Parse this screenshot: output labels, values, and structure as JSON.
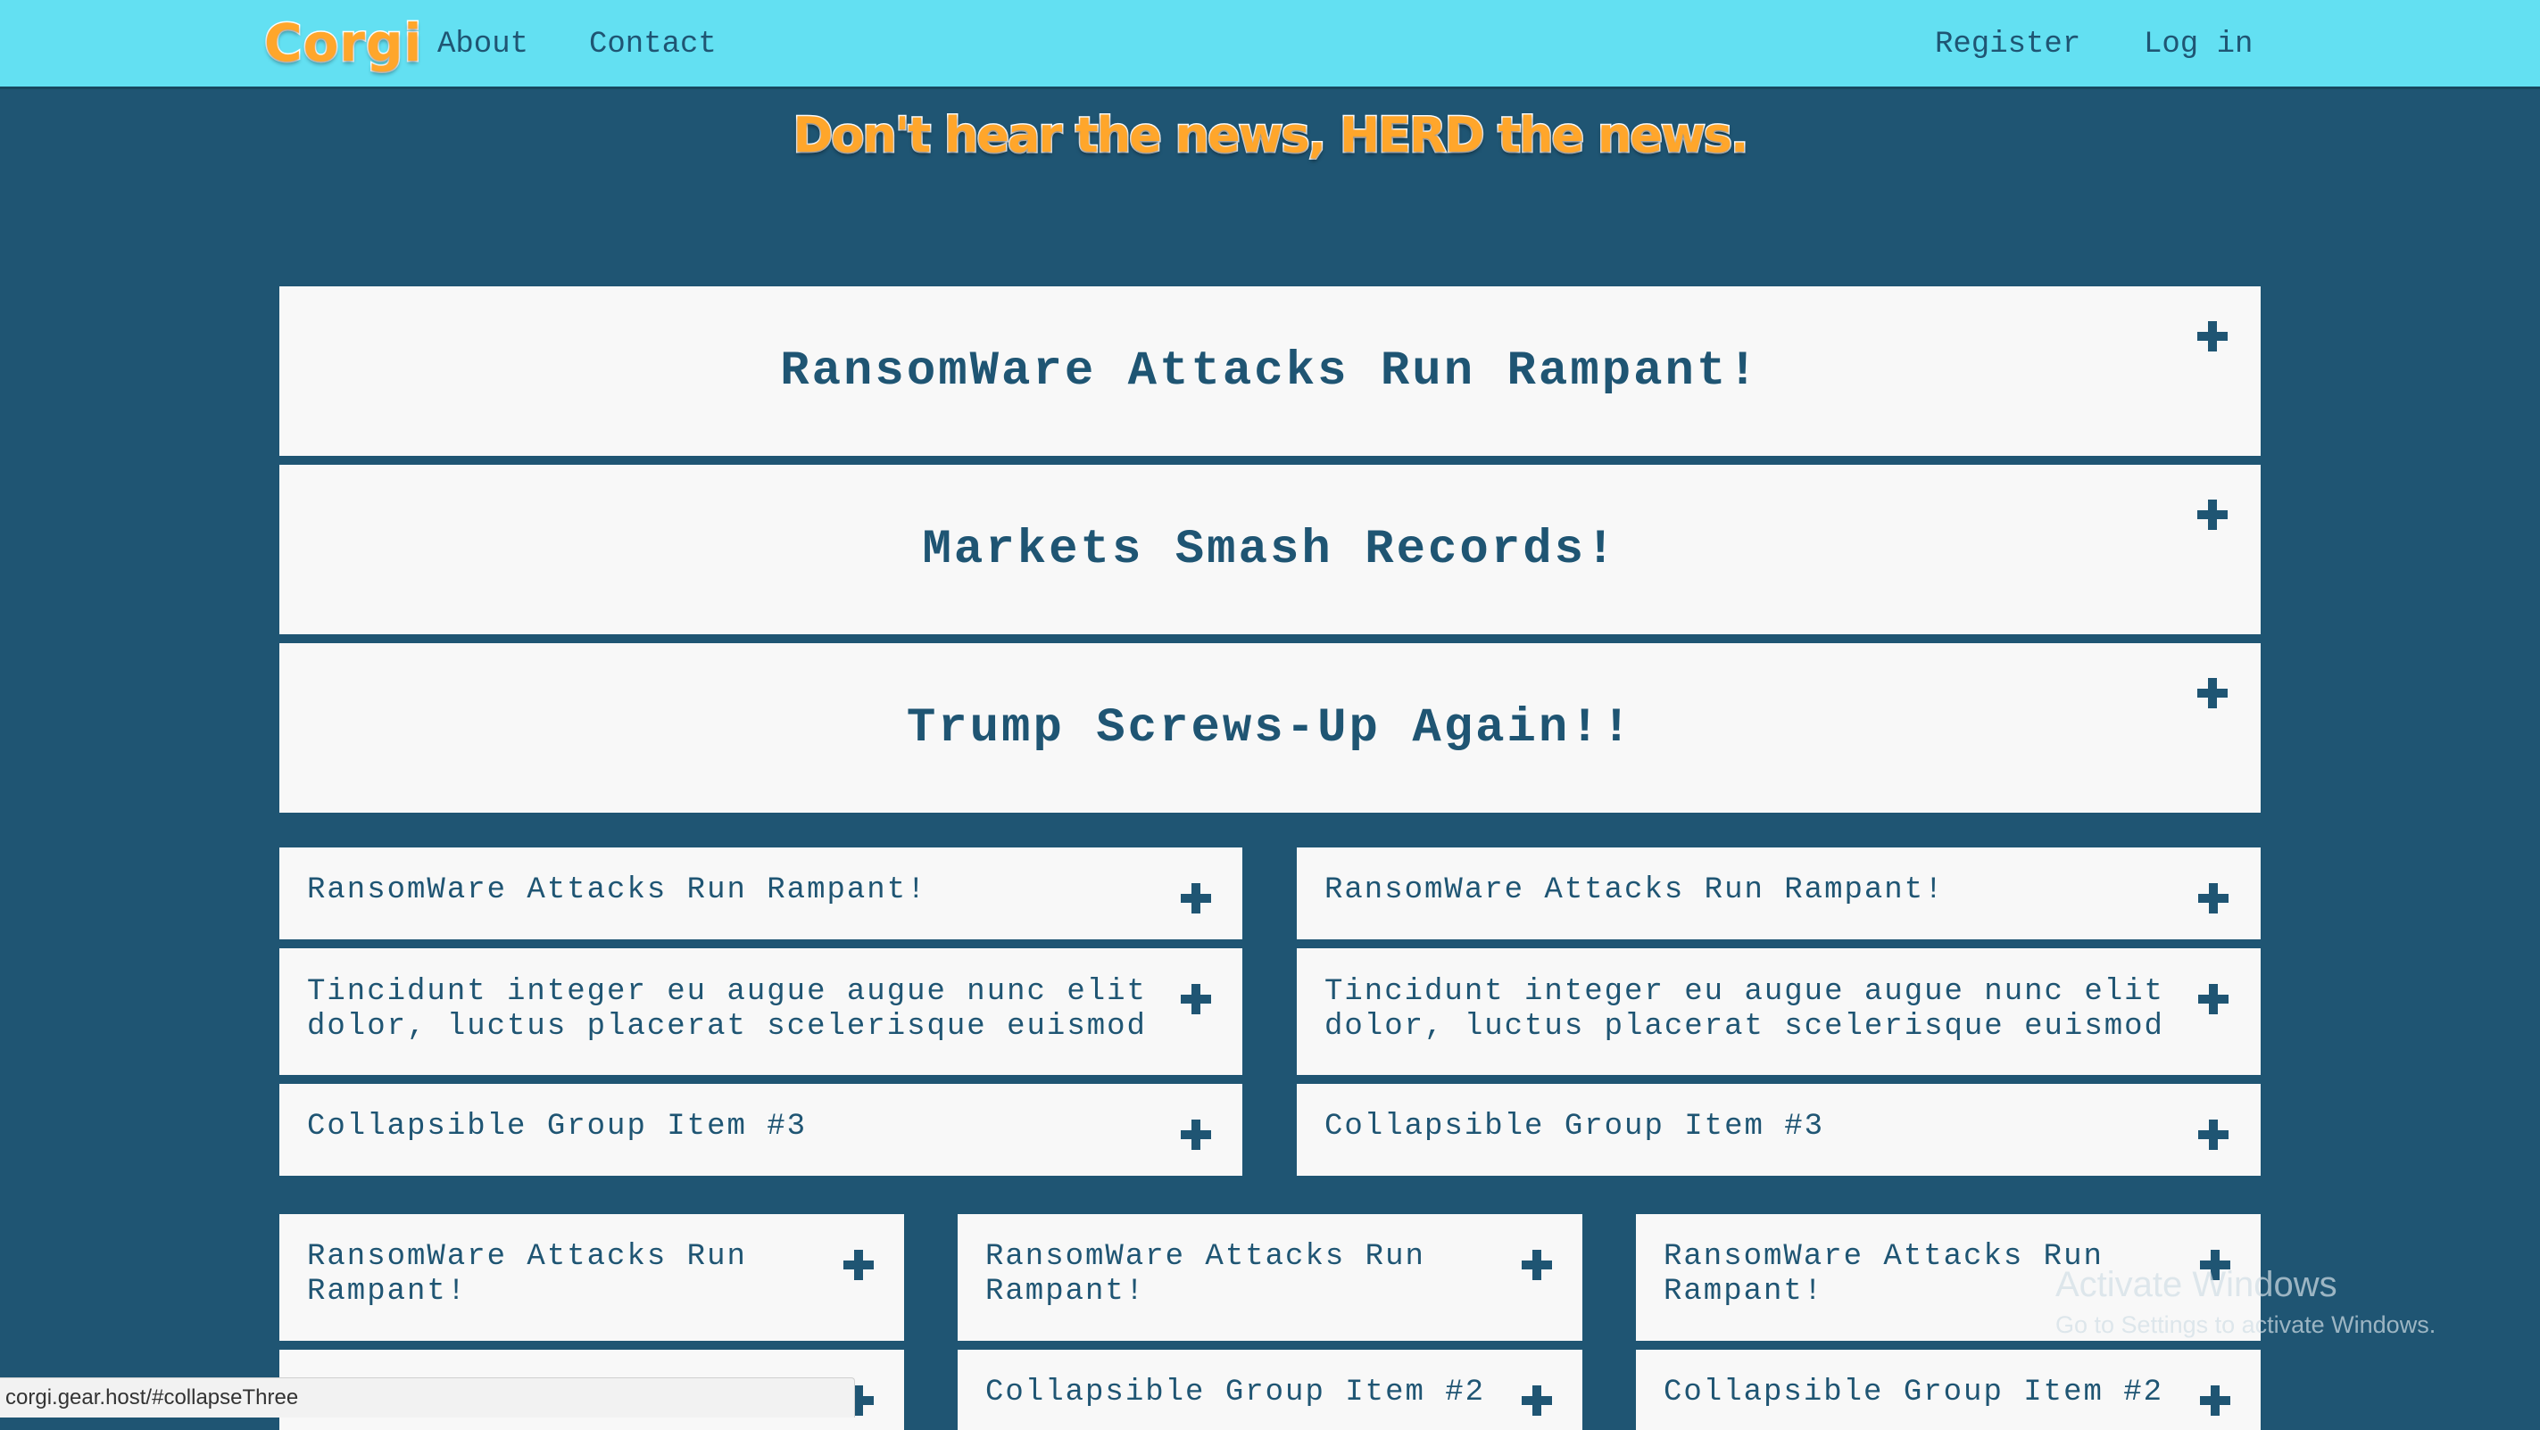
{
  "nav": {
    "logo": "Corgi",
    "links": [
      "About",
      "Contact"
    ],
    "right_links": [
      "Register",
      "Log in"
    ]
  },
  "tagline": "Don't hear the news, HERD the news.",
  "headlines": [
    "RansomWare Attacks Run Rampant!",
    "Markets Smash Records!",
    "Trump Screws-Up Again!!"
  ],
  "two_col": {
    "items": [
      "RansomWare Attacks Run Rampant!",
      "Tincidunt integer eu augue augue nunc elit dolor, luctus placerat scelerisque euismod",
      "Collapsible Group Item #3"
    ]
  },
  "three_col": {
    "items": [
      "RansomWare Attacks Run Rampant!",
      "Collapsible Group Item #2"
    ]
  },
  "status_url": "corgi.gear.host/#collapseThree",
  "watermark": {
    "line1": "Activate Windows",
    "line2": "Go to Settings to activate Windows."
  }
}
